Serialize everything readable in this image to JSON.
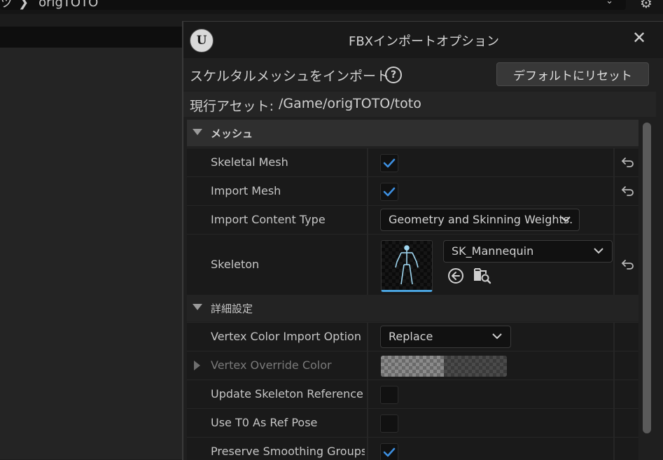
{
  "background": {
    "path_prefix": "ツ",
    "path_folder": "origTOTO"
  },
  "dialog": {
    "title": "FBXインポートオプション",
    "logo_letter": "U",
    "close_glyph": "✕",
    "import_label": "スケルタルメッシュをインポート",
    "help_glyph": "?",
    "reset_button": "デフォルトにリセット",
    "asset_label": "現行アセット:",
    "asset_path": "/Game/origTOTO/toto"
  },
  "categories": {
    "mesh": "メッシュ",
    "advanced": "詳細設定"
  },
  "properties": {
    "skeletal_mesh": {
      "label": "Skeletal Mesh",
      "checked": true
    },
    "import_mesh": {
      "label": "Import Mesh",
      "checked": true
    },
    "import_content_type": {
      "label": "Import Content Type",
      "value": "Geometry and Skinning Weights."
    },
    "skeleton": {
      "label": "Skeleton",
      "value": "SK_Mannequin"
    },
    "vertex_color_import": {
      "label": "Vertex Color Import Option",
      "value": "Replace"
    },
    "vertex_override_color": {
      "label": "Vertex Override Color"
    },
    "update_skeleton_ref": {
      "label": "Update Skeleton Reference P...",
      "checked": false
    },
    "use_t0": {
      "label": "Use T0 As Ref Pose",
      "checked": false
    },
    "preserve_smoothing": {
      "label": "Preserve Smoothing Groups",
      "checked": true
    }
  },
  "colors": {
    "check_accent": "#3d8fe0",
    "thumb_accent": "#4aa3df"
  }
}
